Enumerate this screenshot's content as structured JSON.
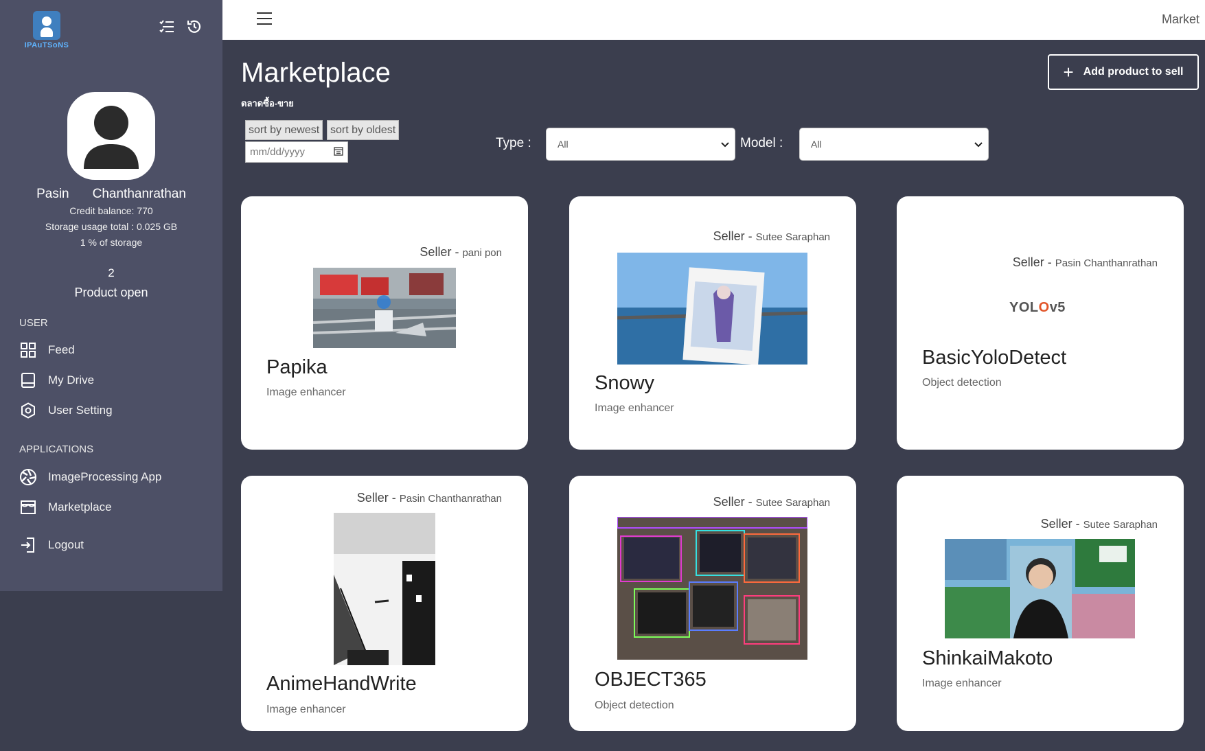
{
  "sidebar": {
    "logo_text": "IPAuTSoNS",
    "profile": {
      "first_name": "Pasin",
      "last_name": "Chanthanrathan",
      "credit_balance": "Credit balance: 770",
      "storage_usage": "Storage usage total : 0.025 GB",
      "storage_percent": "1 % of storage",
      "product_count": "2",
      "product_label": "Product open"
    },
    "user_section": "USER",
    "user_items": [
      {
        "label": "Feed",
        "icon": "grid-icon"
      },
      {
        "label": "My Drive",
        "icon": "drive-icon"
      },
      {
        "label": "User Setting",
        "icon": "settings-icon"
      }
    ],
    "apps_section": "APPLICATIONS",
    "app_items": [
      {
        "label": "ImageProcessing App",
        "icon": "aperture-icon"
      },
      {
        "label": "Marketplace",
        "icon": "store-icon"
      }
    ],
    "logout_label": "Logout"
  },
  "topbar": {
    "right_label": "Market"
  },
  "main": {
    "title": "Marketplace",
    "subtitle": "ตลาดซื้อ-ขาย",
    "add_button": "Add product to sell",
    "sort_newest": "sort by newest",
    "sort_oldest": "sort by oldest",
    "date_placeholder": "mm/dd/yyyy",
    "type_label": "Type :",
    "type_value": "All",
    "model_label": "Model :",
    "model_value": "All"
  },
  "products": [
    {
      "seller_prefix": "Seller - ",
      "seller": "pani pon",
      "name": "Papika",
      "type": "Image enhancer"
    },
    {
      "seller_prefix": "Seller - ",
      "seller": "Sutee Saraphan",
      "name": "Snowy",
      "type": "Image enhancer"
    },
    {
      "seller_prefix": "Seller - ",
      "seller": "Pasin Chanthanrathan",
      "name": "BasicYoloDetect",
      "type": "Object detection",
      "logo_a": "YOL",
      "logo_o": "O",
      "logo_b": "v5"
    },
    {
      "seller_prefix": "Seller - ",
      "seller": "Pasin Chanthanrathan",
      "name": "AnimeHandWrite",
      "type": "Image enhancer"
    },
    {
      "seller_prefix": "Seller - ",
      "seller": "Sutee Saraphan",
      "name": "OBJECT365",
      "type": "Object detection"
    },
    {
      "seller_prefix": "Seller - ",
      "seller": "Sutee Saraphan",
      "name": "ShinkaiMakoto",
      "type": "Image enhancer"
    }
  ],
  "colors": {
    "sidebar_bg": "#4d5066",
    "page_bg": "#3b3e4e",
    "card_bg": "#ffffff"
  }
}
